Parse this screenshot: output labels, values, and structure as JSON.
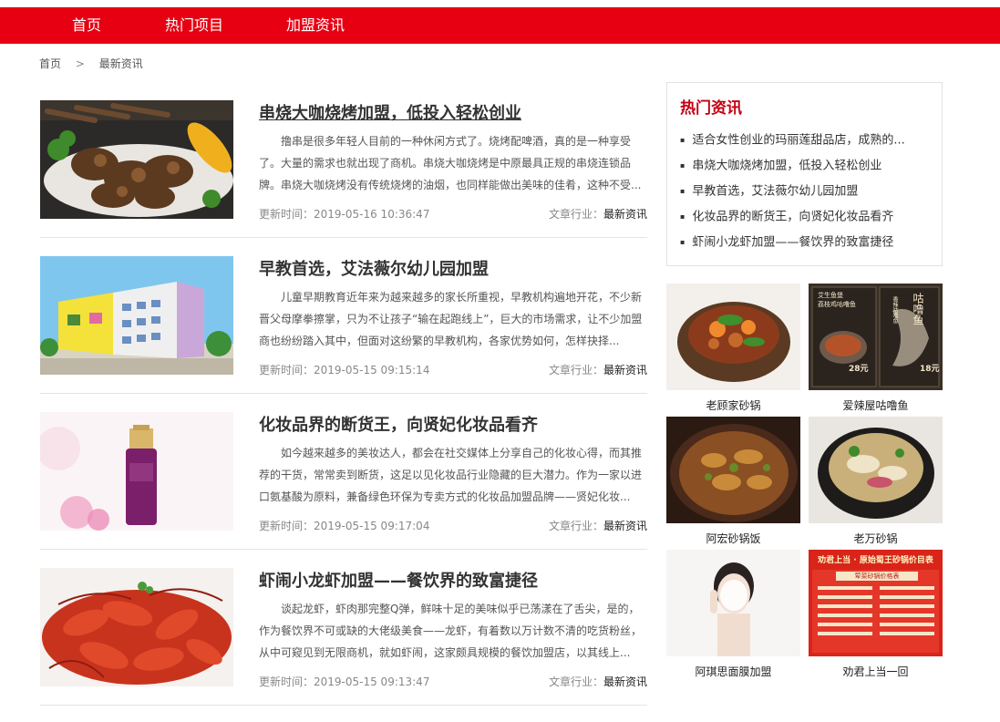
{
  "nav": {
    "items": [
      "首页",
      "热门项目",
      "加盟资讯"
    ]
  },
  "breadcrumb": {
    "home": "首页",
    "sep": ">",
    "current": "最新资讯"
  },
  "colors": {
    "brand_red": "#e60012",
    "hot_title": "#c30012"
  },
  "articles": [
    {
      "title": "串烧大咖烧烤加盟，低投入轻松创业",
      "summary": "撸串是很多年轻人目前的一种休闲方式了。烧烤配啤酒，真的是一种享受了。大量的需求也就出现了商机。串烧大咖烧烤是中原最具正规的串烧连锁品牌。串烧大咖烧烤没有传统烧烤的油烟，也同样能做出美味的佳肴，这种不受...",
      "time": "更新时间：2019-05-16 10:36:47",
      "cat_label": "文章行业：",
      "cat": "最新资讯",
      "image": "bbq-skewers-photo"
    },
    {
      "title": "早教首选，艾法薇尔幼儿园加盟",
      "summary": "儿童早期教育近年来为越来越多的家长所重视，早教机构遍地开花，不少新晋父母摩拳擦掌，只为不让孩子“输在起跑线上”，巨大的市场需求，让不少加盟商也纷纷踏入其中，但面对这纷繁的早教机构，各家优势如何，怎样抉择...",
      "time": "更新时间：2019-05-15 09:15:14",
      "cat_label": "文章行业：",
      "cat": "最新资讯",
      "image": "kindergarten-building-photo"
    },
    {
      "title": "化妆品界的断货王，向贤妃化妆品看齐",
      "summary": "如今越来越多的美妆达人，都会在社交媒体上分享自己的化妆心得，而其推荐的干货，常常卖到断货，这足以见化妆品行业隐藏的巨大潜力。作为一家以进口氨基酸为原料，兼备绿色环保为专卖方式的化妆品加盟品牌——贤妃化妆...",
      "time": "更新时间：2019-05-15 09:17:04",
      "cat_label": "文章行业：",
      "cat": "最新资讯",
      "image": "cosmetic-bottle-photo"
    },
    {
      "title": "虾闹小龙虾加盟——餐饮界的致富捷径",
      "summary": "谈起龙虾，虾肉那完整Q弹，鲜味十足的美味似乎已荡漾在了舌尖，是的，作为餐饮界不可或缺的大佬级美食——龙虾，有着数以万计数不清的吃货粉丝，从中可窥见到无限商机，就如虾闹，这家颇具规模的餐饮加盟店，以其线上...",
      "time": "更新时间：2019-05-15 09:13:47",
      "cat_label": "文章行业：",
      "cat": "最新资讯",
      "image": "crayfish-dish-photo"
    }
  ],
  "hot": {
    "title": "热门资讯",
    "items": [
      "适合女性创业的玛丽莲甜品店，成熟的...",
      "串烧大咖烧烤加盟，低投入轻松创业",
      "早教首选，艾法薇尔幼儿园加盟",
      "化妆品界的断货王，向贤妃化妆品看齐",
      "虾闹小龙虾加盟——餐饮界的致富捷径"
    ]
  },
  "gallery": [
    {
      "caption": "老顾家砂锅",
      "image": "clay-pot-dish-photo"
    },
    {
      "caption": "爱辣屋咕噜鱼",
      "image": "fish-restaurant-poster",
      "poster": {
        "brand": "艾生鱼堡",
        "name": "荔枝鸡咕噜鱼",
        "side": "咕噜鱼",
        "side2": "香辣咕噜鱼",
        "price1": "28元",
        "price2": "18元"
      }
    },
    {
      "caption": "阿宏砂锅饭",
      "image": "mushroom-rice-photo"
    },
    {
      "caption": "老万砂锅",
      "image": "hotpot-soup-photo"
    },
    {
      "caption": "阿琪思面膜加盟",
      "image": "facial-mask-photo"
    },
    {
      "caption": "劝君上当一回",
      "image": "menu-board-photo",
      "poster": {
        "headline": "劝君上当 · 原始蜀王砂锅价目表",
        "sub": "荤菜砂锅价格表"
      }
    }
  ]
}
